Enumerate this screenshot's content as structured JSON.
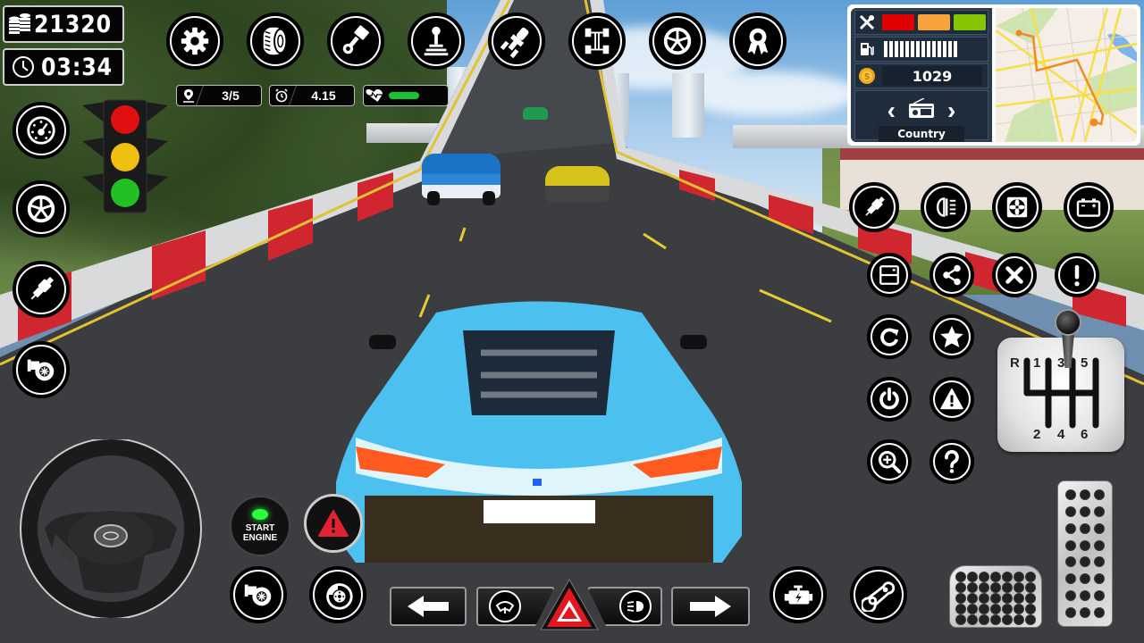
{
  "hud": {
    "money": {
      "icon": "coins-icon",
      "value": "21320"
    },
    "timer": {
      "icon": "clock-icon",
      "value": "03:34"
    },
    "lap": {
      "icon": "location-pin-icon",
      "value": "3/5"
    },
    "race_time": {
      "icon": "alarm-clock-icon",
      "value": "4.15"
    },
    "health": {
      "icon": "heart-health-icon",
      "fraction": 0.6,
      "color": "#19c433"
    }
  },
  "top_buttons": [
    {
      "name": "settings",
      "icon": "gear-icon"
    },
    {
      "name": "tires",
      "icon": "tire-icon"
    },
    {
      "name": "engine-piston",
      "icon": "piston-icon"
    },
    {
      "name": "gear-lever",
      "icon": "joystick-icon"
    },
    {
      "name": "headlight-bulb",
      "icon": "bulb-icon"
    },
    {
      "name": "chassis",
      "icon": "chassis-icon"
    },
    {
      "name": "rims",
      "icon": "wheel-rim-icon"
    },
    {
      "name": "achievements",
      "icon": "award-ribbon-icon"
    }
  ],
  "left_buttons": [
    {
      "name": "speedometer",
      "icon": "speedometer-icon"
    },
    {
      "name": "wheel",
      "icon": "wheel-rim-icon"
    },
    {
      "name": "spark-plug",
      "icon": "spark-plug-icon"
    },
    {
      "name": "turbo",
      "icon": "turbo-icon"
    }
  ],
  "traffic_light": {
    "red": "#e01010",
    "yellow": "#f0c010",
    "green": "#22c022"
  },
  "status_panel": {
    "repair_icon": "tools-icon",
    "damage_colors": [
      "#e00000",
      "#f7a23a",
      "#86c500"
    ],
    "fuel_icon": "fuel-pump-icon",
    "fuel_ticks": 14,
    "coin_icon": "gold-coin-icon",
    "coins": "1029",
    "radio_icon": "radio-icon",
    "radio_station": "Country",
    "prev_label": "‹",
    "next_label": "›",
    "map_icon": "minimap"
  },
  "right_buttons_row1": [
    {
      "name": "spark-plug",
      "icon": "spark-plug-icon"
    },
    {
      "name": "headlights",
      "icon": "high-beam-icon"
    },
    {
      "name": "fan",
      "icon": "fan-icon"
    },
    {
      "name": "battery",
      "icon": "battery-icon"
    }
  ],
  "right_buttons_row2": [
    {
      "name": "save",
      "icon": "save-icon"
    },
    {
      "name": "share",
      "icon": "share-icon"
    },
    {
      "name": "close",
      "icon": "close-icon"
    },
    {
      "name": "alert",
      "icon": "exclamation-icon"
    }
  ],
  "right_grid": [
    {
      "name": "restart",
      "icon": "restart-icon"
    },
    {
      "name": "favorite",
      "icon": "star-icon"
    },
    {
      "name": "power",
      "icon": "power-icon"
    },
    {
      "name": "warning",
      "icon": "warning-icon"
    },
    {
      "name": "zoom-in",
      "icon": "zoom-in-icon"
    },
    {
      "name": "help",
      "icon": "question-icon"
    }
  ],
  "gearbox": {
    "labels": {
      "r": "R",
      "g1": "1",
      "g2": "2",
      "g3": "3",
      "g4": "4",
      "g5": "5",
      "g6": "6"
    }
  },
  "bottom_controls": {
    "start_engine": {
      "line1": "START",
      "line2": "ENGINE"
    },
    "turbo": "turbo-icon",
    "brake_disc": "brake-disc-icon",
    "left_arrow": "arrow-left-icon",
    "wiper": "wiper-icon",
    "hazard": "hazard-icon",
    "fog_light": "fog-light-icon",
    "right_arrow": "arrow-right-icon",
    "engine": "engine-check-icon",
    "timing_belt": "timing-belt-icon"
  }
}
